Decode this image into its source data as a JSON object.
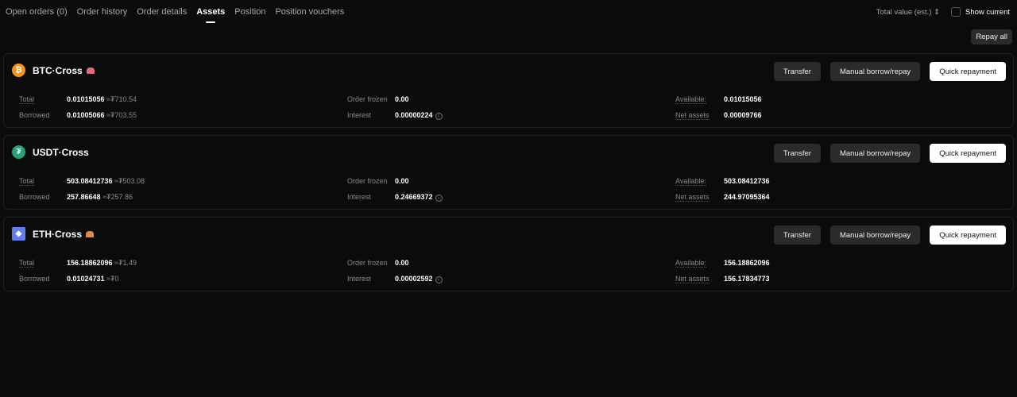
{
  "tabs": [
    {
      "label": "Open orders (0)"
    },
    {
      "label": "Order history"
    },
    {
      "label": "Order details"
    },
    {
      "label": "Assets",
      "active": true
    },
    {
      "label": "Position"
    },
    {
      "label": "Position vouchers"
    }
  ],
  "toolbar": {
    "total_value": "Total value (est.) ⇕",
    "show_current": "Show current",
    "repay_all": "Repay all"
  },
  "labels": {
    "total": "Total",
    "borrowed": "Borrowed",
    "order_frozen": "Order frozen",
    "interest": "Interest",
    "available": "Available:",
    "net_assets": "Net assets",
    "transfer": "Transfer",
    "manual": "Manual borrow/repay",
    "quick": "Quick repayment"
  },
  "cards": [
    {
      "name": "BTC·Cross",
      "icon": "bitcoin-icon",
      "color": "#f7931a",
      "alert": "#e46a7a",
      "total": "0.01015056",
      "total_approx": "≈₮710.54",
      "borrowed": "0.01005066",
      "borrowed_approx": "≈₮703.55",
      "order_frozen": "0.00",
      "interest": "0.00000224",
      "available": "0.01015056",
      "net_assets": "0.00009766"
    },
    {
      "name": "USDT·Cross",
      "icon": "tether-icon",
      "color": "#26a17b",
      "total": "503.08412736",
      "total_approx": "≈₮503.08",
      "borrowed": "257.86648",
      "borrowed_approx": "≈₮257.86",
      "order_frozen": "0.00",
      "interest": "0.24669372",
      "available": "503.08412736",
      "net_assets": "244.97095364"
    },
    {
      "name": "ETH·Cross",
      "icon": "ethereum-icon",
      "color": "#627eea",
      "alert": "#e08a4a",
      "total": "156.18862096",
      "total_approx": "≈₮1.49",
      "borrowed": "0.01024731",
      "borrowed_approx": "≈₮0",
      "order_frozen": "0.00",
      "interest": "0.00002592",
      "available": "156.18862096",
      "net_assets": "156.17834773"
    }
  ]
}
